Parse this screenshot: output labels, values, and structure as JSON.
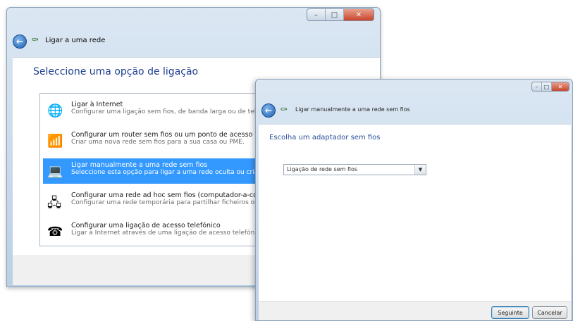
{
  "window1": {
    "title": "Ligar a uma rede",
    "heading": "Seleccione uma opção de ligação",
    "options": [
      {
        "icon": "globe-icon",
        "title": "Ligar à Internet",
        "desc": "Configurar uma ligação sem fios, de banda larga ou de telefo"
      },
      {
        "icon": "router-icon",
        "title": "Configurar um router sem fios ou um ponto de acesso",
        "desc": "Criar uma nova rede sem fios para a sua casa ou PME."
      },
      {
        "icon": "network-computer-icon",
        "title": "Ligar manualmente a uma rede sem fios",
        "desc": "Seleccione esta opção para ligar a uma rede oculta ou criar u",
        "selected": true
      },
      {
        "icon": "adhoc-network-icon",
        "title": "Configurar uma rede ad hoc sem fios (computador-a-compu",
        "desc": "Configurar uma rede temporária para partilhar ficheiros ou u"
      },
      {
        "icon": "telephone-icon",
        "title": "Configurar uma ligação de acesso telefónico",
        "desc": "Ligar à Internet através de uma ligação de acesso telefónico."
      }
    ]
  },
  "window2": {
    "title": "Ligar manualmente a uma rede sem fios",
    "heading": "Escolha um adaptador sem fios",
    "adapter_selected": "Ligação de rede sem fios",
    "next_label": "Seguinte",
    "cancel_label": "Cancelar"
  },
  "colors": {
    "heading_blue": "#1e3f8f",
    "selection_blue": "#3399ff",
    "close_red": "#c9452c"
  }
}
